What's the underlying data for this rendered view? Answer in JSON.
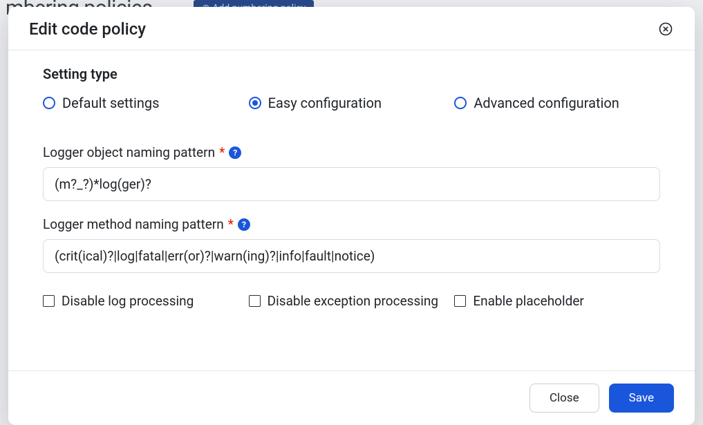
{
  "background": {
    "page_title_fragment": "mbering policies",
    "add_button": "⊕ Add numbering policy"
  },
  "modal": {
    "title": "Edit code policy",
    "setting_type": {
      "heading": "Setting type",
      "options": {
        "default": "Default settings",
        "easy": "Easy configuration",
        "advanced": "Advanced configuration"
      },
      "selected": "easy"
    },
    "fields": {
      "object_pattern": {
        "label": "Logger object naming pattern",
        "value": "(m?_?)*log(ger)?"
      },
      "method_pattern": {
        "label": "Logger method naming pattern",
        "value": "(crit(ical)?|log|fatal|err(or)?|warn(ing)?|info|fault|notice)"
      }
    },
    "checkboxes": {
      "disable_log": "Disable log processing",
      "disable_exception": "Disable exception processing",
      "enable_placeholder": "Enable placeholder"
    },
    "footer": {
      "close": "Close",
      "save": "Save"
    }
  }
}
